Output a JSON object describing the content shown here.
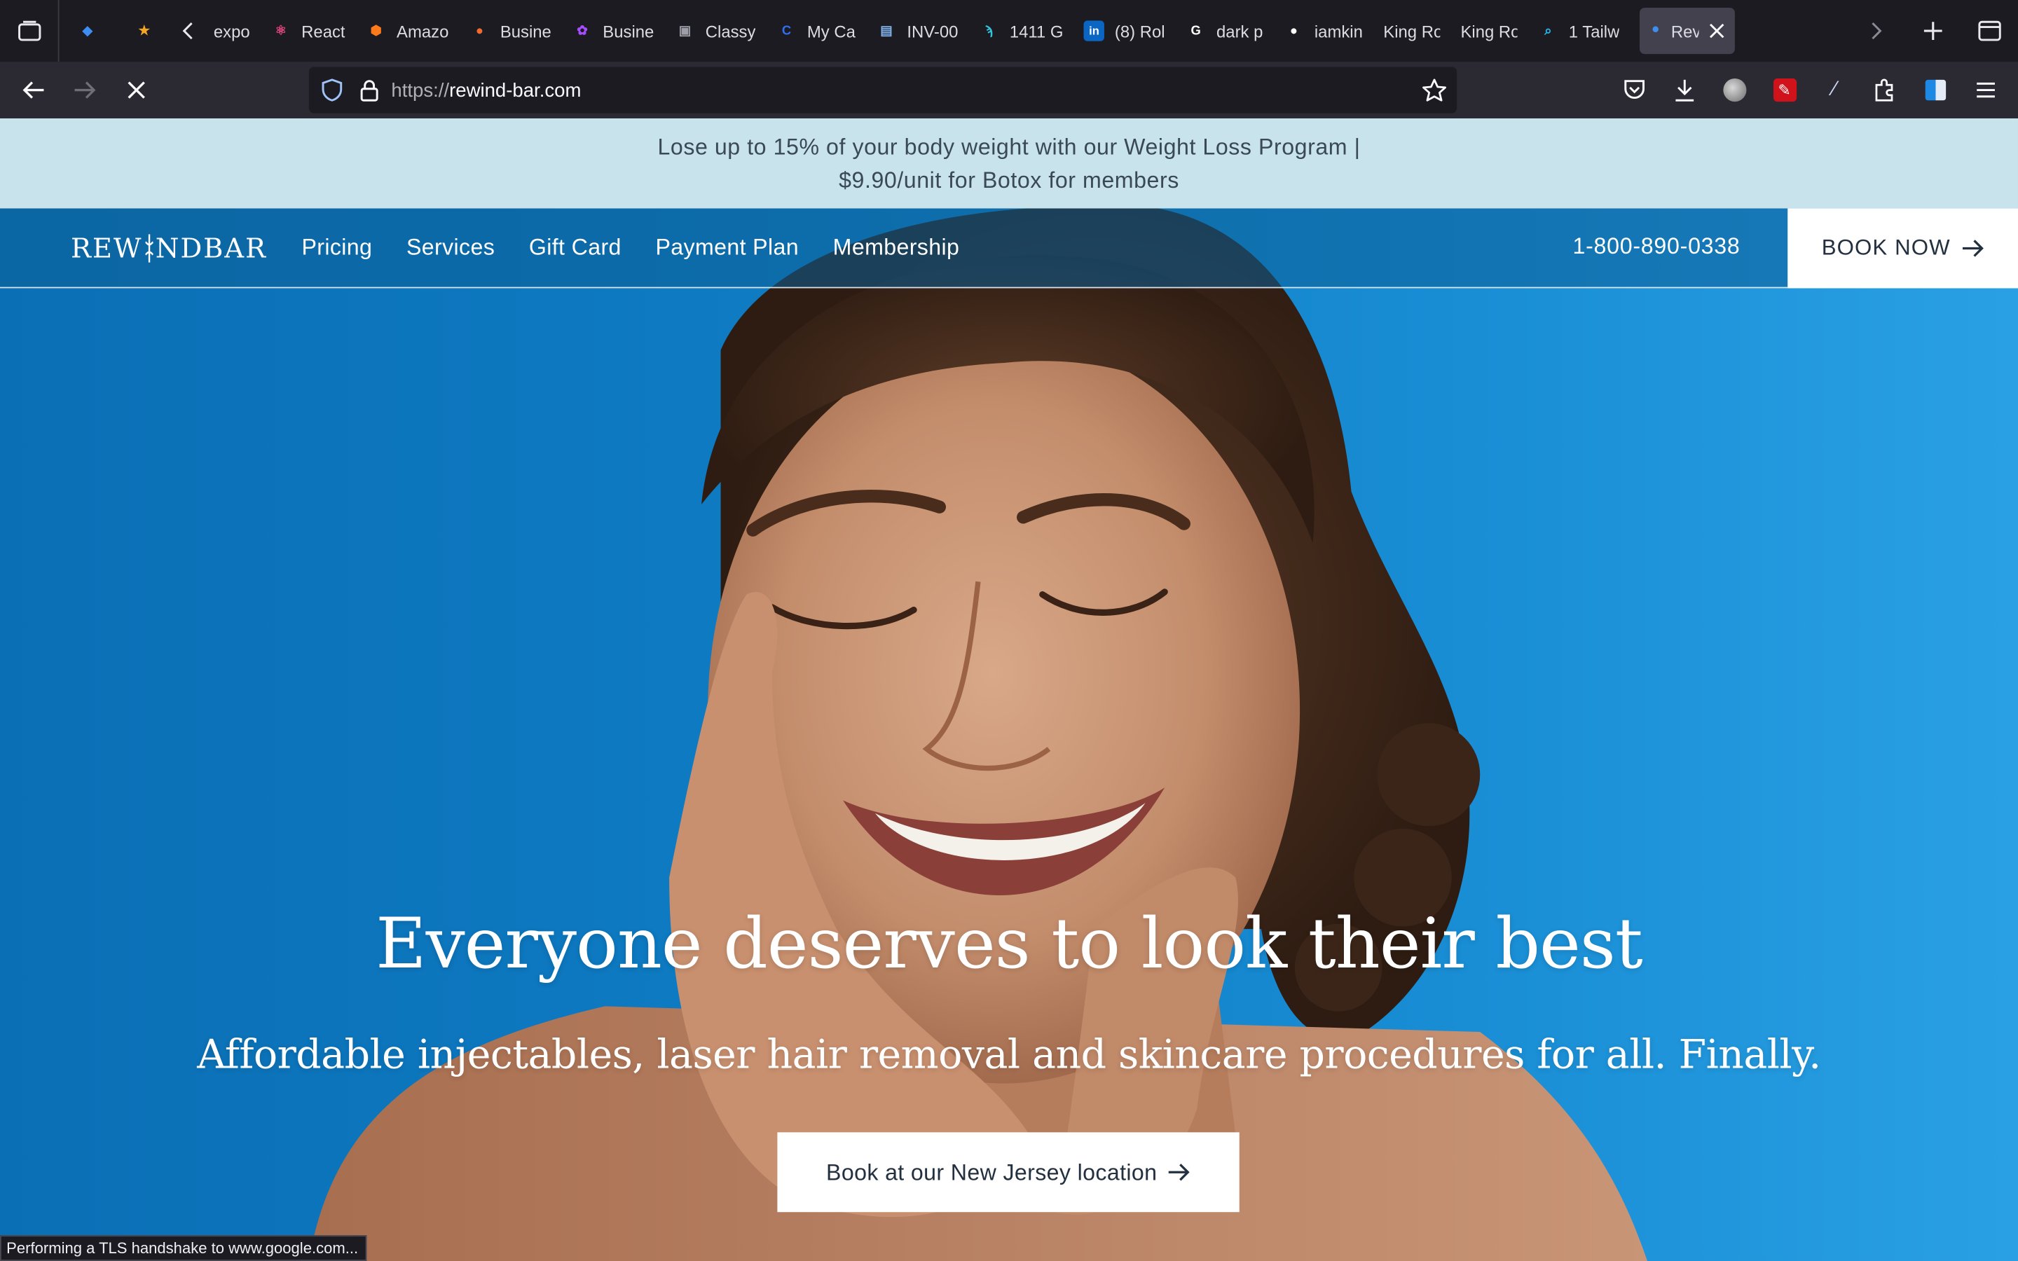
{
  "browser": {
    "tabs": [
      {
        "label": "",
        "icon": "sketch-diamond-icon",
        "color": "#3d8ef0",
        "pinned": true
      },
      {
        "label": "",
        "icon": "star-badge-icon",
        "color": "#f5a623",
        "pinned": true
      },
      {
        "label": "expo",
        "icon": "none",
        "color": ""
      },
      {
        "label": "React",
        "icon": "react-atom-icon",
        "color": "#e0457b"
      },
      {
        "label": "Amazo",
        "icon": "amazon-box-icon",
        "color": "#ff7a1a"
      },
      {
        "label": "Busine",
        "icon": "business-circle-icon",
        "color": "#f26a2e"
      },
      {
        "label": "Busine",
        "icon": "business-flower-icon",
        "color": "#a64dff"
      },
      {
        "label": "Classy",
        "icon": "image-icon",
        "color": "#9e9ea8"
      },
      {
        "label": "My Ca",
        "icon": "c-circle-icon",
        "color": "#2f6ff0"
      },
      {
        "label": "INV-00",
        "icon": "invoice-icon",
        "color": "#7fb0e8"
      },
      {
        "label": "1411 G",
        "icon": "spiral-icon",
        "color": "#33c4d9"
      },
      {
        "label": "(8) Rol",
        "icon": "linkedin-icon",
        "color": "#0a66c2"
      },
      {
        "label": "dark p",
        "icon": "google-icon",
        "color": "#ffffff"
      },
      {
        "label": "iamkin",
        "icon": "github-icon",
        "color": "#ffffff"
      },
      {
        "label": "King Robe",
        "icon": "none",
        "color": ""
      },
      {
        "label": "King Robe",
        "icon": "none",
        "color": ""
      },
      {
        "label": "1 Tailw",
        "icon": "search-bubble-icon",
        "color": "#2ab7f0"
      },
      {
        "label": "Rev",
        "icon": "loading-dot-icon",
        "color": "#3d8ef0",
        "active": true
      }
    ],
    "url_scheme": "https://",
    "url_host": "rewind-bar.com",
    "status_text": "Performing a TLS handshake to www.google.com..."
  },
  "page": {
    "promo_line1": "Lose up to 15% of your body weight with our Weight Loss Program |",
    "promo_line2": "$9.90/unit for Botox for members",
    "logo_left": "REW",
    "logo_right": "NDBAR",
    "nav": [
      "Pricing",
      "Services",
      "Gift Card",
      "Payment Plan",
      "Membership"
    ],
    "phone": "1-800-890-0338",
    "book_now": "BOOK NOW",
    "headline": "Everyone deserves to look their best",
    "subhead": "Affordable injectables, laser hair removal and skincare procedures for all. Finally.",
    "cta": "Book at our New Jersey location"
  },
  "colors": {
    "promo_bg": "#c8e3ec",
    "hero_blue": "#0e7cc4",
    "chrome_dark": "#1c1b22"
  }
}
